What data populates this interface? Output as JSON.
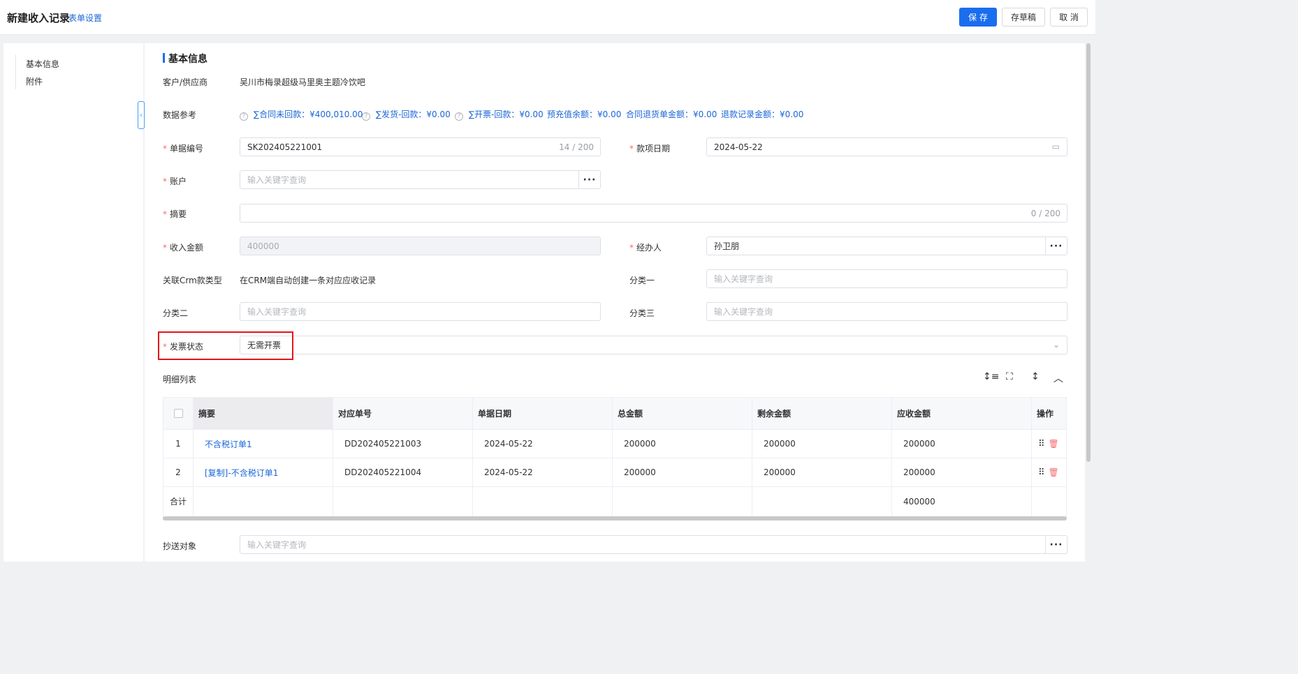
{
  "header": {
    "title": "新建收入记录",
    "form_settings": "表单设置",
    "save": "保 存",
    "draft": "存草稿",
    "cancel": "取 消"
  },
  "sidenav": {
    "items": [
      "基本信息",
      "附件"
    ]
  },
  "section_title": "基本信息",
  "form": {
    "customer_label": "客户/供应商",
    "customer_value": "吴川市梅录超级马里奥主题冷饮吧",
    "ref_label": "数据参考",
    "refs": [
      "∑合同未回款：¥400,010.00",
      "∑发货-回款：¥0.00",
      "∑开票-回款：¥0.00",
      "预充值余额：¥0.00",
      "合同退货单金额：¥0.00",
      "退款记录金额：¥0.00"
    ],
    "doc_no_label": "单据编号",
    "doc_no_value": "SK202405221001",
    "doc_no_count": "14 / 200",
    "date_label": "款项日期",
    "date_value": "2024-05-22",
    "account_label": "账户",
    "account_placeholder": "输入关键字查询",
    "summary_label": "摘要",
    "summary_count": "0 / 200",
    "amount_label": "收入金额",
    "amount_value": "400000",
    "handler_label": "经办人",
    "handler_value": "孙卫朋",
    "crm_type_label": "关联Crm款类型",
    "crm_type_value": "在CRM端自动创建一条对应应收记录",
    "cat1_label": "分类一",
    "cat1_placeholder": "输入关键字查询",
    "cat2_label": "分类二",
    "cat2_placeholder": "输入关键字查询",
    "cat3_label": "分类三",
    "cat3_placeholder": "输入关键字查询",
    "invoice_status_label": "发票状态",
    "invoice_status_value": "无需开票",
    "cc_label": "抄送对象",
    "cc_placeholder": "输入关键字查询"
  },
  "detail": {
    "title": "明细列表",
    "columns": [
      "摘要",
      "对应单号",
      "单据日期",
      "总金额",
      "剩余金额",
      "应收金额",
      "操作"
    ],
    "rows": [
      {
        "idx": "1",
        "summary": "不含税订单1",
        "order_no": "DD202405221003",
        "date": "2024-05-22",
        "total": "200000",
        "remaining": "200000",
        "receivable": "200000"
      },
      {
        "idx": "2",
        "summary": "[复制]-不含税订单1",
        "order_no": "DD202405221004",
        "date": "2024-05-22",
        "total": "200000",
        "remaining": "200000",
        "receivable": "200000"
      }
    ],
    "total_label": "合计",
    "total_receivable": "400000"
  }
}
